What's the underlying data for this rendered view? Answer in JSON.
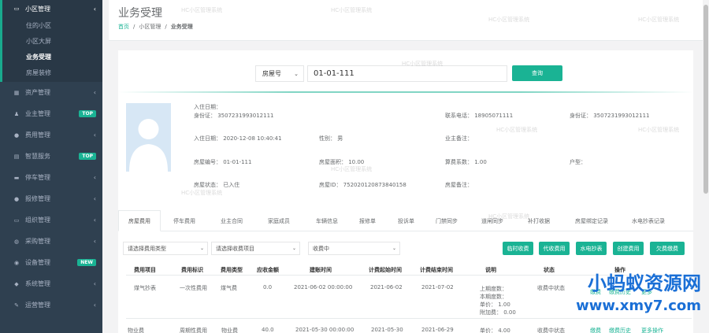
{
  "sidebar": {
    "group": {
      "label": "小区管理",
      "icon": "monitor-icon"
    },
    "sub_items": [
      {
        "label": "住的小区",
        "active": false
      },
      {
        "label": "小区大屏",
        "active": false
      },
      {
        "label": "业务受理",
        "active": true
      },
      {
        "label": "房屋装修",
        "active": false
      }
    ],
    "items": [
      {
        "label": "资产管理",
        "icon": "grid-icon",
        "badge": ""
      },
      {
        "label": "业主管理",
        "icon": "user-icon",
        "badge": "TOP"
      },
      {
        "label": "费用管理",
        "icon": "globe-icon",
        "badge": ""
      },
      {
        "label": "智慧服务",
        "icon": "card-icon",
        "badge": "TOP"
      },
      {
        "label": "停车管理",
        "icon": "car-icon",
        "badge": ""
      },
      {
        "label": "报修管理",
        "icon": "globe-icon",
        "badge": ""
      },
      {
        "label": "组织管理",
        "icon": "desktop-icon",
        "badge": ""
      },
      {
        "label": "采购管理",
        "icon": "cart-icon",
        "badge": ""
      },
      {
        "label": "设备管理",
        "icon": "device-icon",
        "badge": "NEW"
      },
      {
        "label": "系统管理",
        "icon": "diamond-icon",
        "badge": ""
      },
      {
        "label": "运营管理",
        "icon": "wrench-icon",
        "badge": ""
      }
    ]
  },
  "header": {
    "title": "业务受理",
    "breadcrumb": [
      "首页",
      "小区管理",
      "业务受理"
    ]
  },
  "search": {
    "type_label": "房屋号",
    "value": "01-01-111",
    "button": "查询"
  },
  "owner": {
    "name_label": "入住日期：",
    "id_card": "身份证：  3507231993012111",
    "contact": "联系电话：  18905071111",
    "id_card2": "身份证：  3507231993012111",
    "checkin": "入住日期：  2020-12-08 10:40:41",
    "gender": "性别：  男",
    "owner_remark": "业主备注：",
    "room_no": "房屋编号：  01-01-111",
    "room_area": "房屋面积：  10.00",
    "coefficient": "算费系数：  1.00",
    "house_type": "户型：",
    "room_status": "房屋状态：  已入住",
    "room_id": "房屋ID：  752020120873840158",
    "room_remark": "房屋备注："
  },
  "tabs": [
    "房屋费用",
    "停车费用",
    "业主合同",
    "家庭成员",
    "车辆信息",
    "报修单",
    "投诉单",
    "门禁同步",
    "道闸同步",
    "补打收据",
    "房屋绑定记录",
    "水电抄表记录"
  ],
  "filters": {
    "fee_type": "请选择费用类型",
    "fee_item": "请选择收费项目",
    "fee_status": "收费中"
  },
  "actions": [
    "临时收费",
    "代收费用",
    "水电抄表",
    "创建费用",
    "欠费缴费"
  ],
  "table": {
    "headers": [
      "费用项目",
      "费用标识",
      "费用类型",
      "应收金额",
      "建账时间",
      "计费起始时间",
      "计费结束时间",
      "说明",
      "状态",
      "操作"
    ],
    "rows": [
      {
        "item": "煤气抄表",
        "flag": "一次性费用",
        "type": "煤气费",
        "amount": "0.0",
        "created": "2021-06-02 00:00:00",
        "start": "2021-06-02",
        "end": "2021-07-02",
        "notes": [
          "上期度数：",
          "本期度数：",
          "单价：  1.00",
          "附加费：  0.00"
        ],
        "status": "收费中状态",
        "ops": [
          "缴费",
          "缴费历史",
          "更多"
        ]
      },
      {
        "item": "物业费",
        "flag": "周期性费用",
        "type": "物业费",
        "amount": "40.0",
        "created": "2021-05-30 00:00:00",
        "start": "2021-05-30",
        "end": "2021-06-29",
        "notes": [
          "单价：  4.00"
        ],
        "status": "收费中状态",
        "ops": [
          "缴费",
          "缴费历史",
          "更多操作"
        ]
      }
    ]
  },
  "brand": {
    "name": "小蚂蚁资源网",
    "url": "www.xmy7.com",
    "color": "#1a6fd6"
  },
  "watermark": "HC小区管理系统"
}
